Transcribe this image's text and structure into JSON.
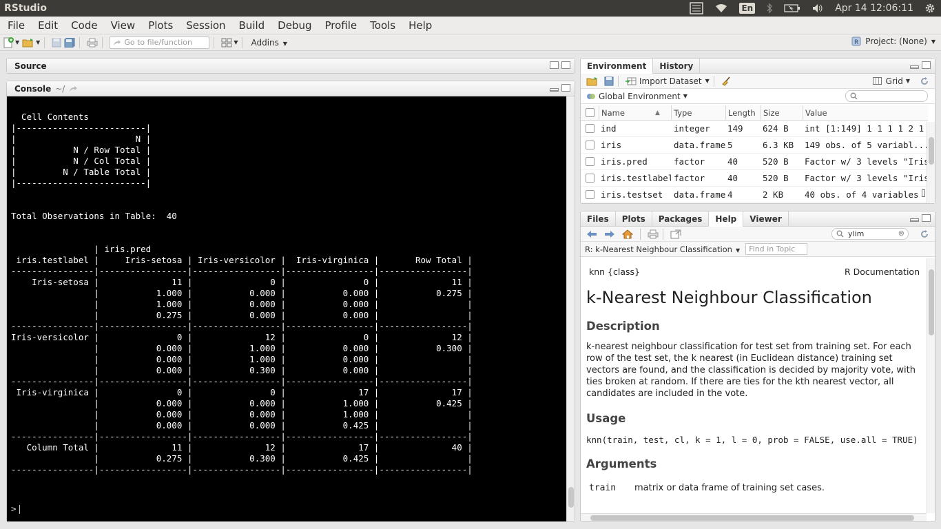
{
  "topbar": {
    "title": "RStudio",
    "lang": "En",
    "clock": "Apr 14 12:06:11"
  },
  "menu": [
    "File",
    "Edit",
    "Code",
    "View",
    "Plots",
    "Session",
    "Build",
    "Debug",
    "Profile",
    "Tools",
    "Help"
  ],
  "toolbar": {
    "goto_placeholder": "Go to file/function",
    "addins": "Addins",
    "project": "Project: (None)"
  },
  "source": {
    "title": "Source"
  },
  "console": {
    "title": "Console",
    "path": "~/",
    "output": "\n  Cell Contents\n|-------------------------|\n|                       N |\n|           N / Row Total |\n|           N / Col Total |\n|         N / Table Total |\n|-------------------------|\n\n\nTotal Observations in Table:  40 \n\n\n                | iris.pred \n iris.testlabel |     Iris-setosa | Iris-versicolor |  Iris-virginica |       Row Total | \n----------------|-----------------|-----------------|-----------------|-----------------|\n    Iris-setosa |              11 |               0 |               0 |              11 | \n                |           1.000 |           0.000 |           0.000 |           0.275 | \n                |           1.000 |           0.000 |           0.000 |                 | \n                |           0.275 |           0.000 |           0.000 |                 | \n----------------|-----------------|-----------------|-----------------|-----------------|\nIris-versicolor |               0 |              12 |               0 |              12 | \n                |           0.000 |           1.000 |           0.000 |           0.300 | \n                |           0.000 |           1.000 |           0.000 |                 | \n                |           0.000 |           0.300 |           0.000 |                 | \n----------------|-----------------|-----------------|-----------------|-----------------|\n Iris-virginica |               0 |               0 |              17 |              17 | \n                |           0.000 |           0.000 |           1.000 |           0.425 | \n                |           0.000 |           0.000 |           1.000 |                 | \n                |           0.000 |           0.000 |           0.425 |                 | \n----------------|-----------------|-----------------|-----------------|-----------------|\n   Column Total |              11 |              12 |              17 |              40 | \n                |           0.275 |           0.300 |           0.425 |                 | \n----------------|-----------------|-----------------|-----------------|-----------------|",
    "prompt": ">"
  },
  "env": {
    "tabs": [
      "Environment",
      "History"
    ],
    "import_dataset": "Import Dataset",
    "grid_label": "Grid",
    "scope": "Global Environment",
    "columns": [
      "Name",
      "Type",
      "Length",
      "Size",
      "Value"
    ],
    "rows": [
      {
        "name": "ind",
        "type": "integer",
        "length": "149",
        "size": "624 B",
        "value": "int [1:149] 1 1 1 1 2 1 ..."
      },
      {
        "name": "iris",
        "type": "data.frame",
        "length": "5",
        "size": "6.3 KB",
        "value": "149 obs. of 5 variabl..."
      },
      {
        "name": "iris.pred",
        "type": "factor",
        "length": "40",
        "size": "520 B",
        "value": "Factor w/ 3 levels \"Iris..."
      },
      {
        "name": "iris.testlabel",
        "type": "factor",
        "length": "40",
        "size": "520 B",
        "value": "Factor w/ 3 levels \"Iris..."
      },
      {
        "name": "iris.testset",
        "type": "data.frame",
        "length": "4",
        "size": "2 KB",
        "value": "40 obs. of 4 variables"
      }
    ]
  },
  "help": {
    "tabs": [
      "Files",
      "Plots",
      "Packages",
      "Help",
      "Viewer"
    ],
    "search_value": "ylim",
    "topic": "R: k-Nearest Neighbour Classification",
    "find_placeholder": "Find in Topic",
    "doc_left": "knn {class}",
    "doc_right": "R Documentation",
    "doc_title": "k-Nearest Neighbour Classification",
    "h_description": "Description",
    "description": "k-nearest neighbour classification for test set from training set. For each row of the test set, the k nearest (in Euclidean distance) training set vectors are found, and the classification is decided by majority vote, with ties broken at random. If there are ties for the kth nearest vector, all candidates are included in the vote.",
    "h_usage": "Usage",
    "usage": "knn(train, test, cl, k = 1, l = 0, prob = FALSE, use.all = TRUE)",
    "h_arguments": "Arguments",
    "arg_name": "train",
    "arg_desc": "matrix or data frame of training set cases."
  }
}
